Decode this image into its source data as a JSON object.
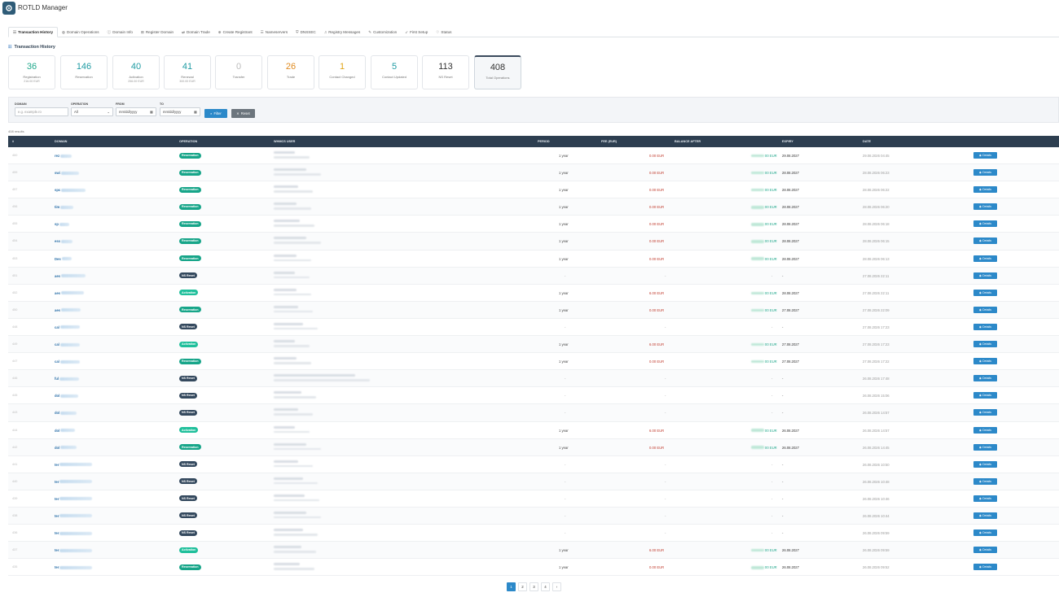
{
  "app": {
    "title": "ROTLD Manager"
  },
  "tabs": [
    {
      "label": "Transaction History",
      "icon": "table-icon",
      "glyph": "☷"
    },
    {
      "label": "Domain Operations",
      "icon": "globe-icon",
      "glyph": "◍"
    },
    {
      "label": "Domain Info",
      "icon": "info-icon",
      "glyph": "ⓘ"
    },
    {
      "label": "Register Domain",
      "icon": "plus-square-icon",
      "glyph": "⊞"
    },
    {
      "label": "Domain Trade",
      "icon": "exchange-icon",
      "glyph": "⇄"
    },
    {
      "label": "Create Registrant",
      "icon": "user-plus-icon",
      "glyph": "⊕"
    },
    {
      "label": "Nameservers",
      "icon": "server-icon",
      "glyph": "☰"
    },
    {
      "label": "DNSSEC",
      "icon": "shield-icon",
      "glyph": "⛨"
    },
    {
      "label": "Registry Messages",
      "icon": "bell-icon",
      "glyph": "♫"
    },
    {
      "label": "Customization",
      "icon": "brush-icon",
      "glyph": "✎"
    },
    {
      "label": "First Setup",
      "icon": "rocket-icon",
      "glyph": "➶"
    },
    {
      "label": "Status",
      "icon": "heartbeat-icon",
      "glyph": "♡"
    }
  ],
  "section_title": "Transaction History",
  "stats": [
    {
      "value": "36",
      "label": "Registration",
      "sub": "216.00 EUR",
      "color": "#1fa88b"
    },
    {
      "value": "146",
      "label": "Reservation",
      "sub": "",
      "color": "#1f9ba3"
    },
    {
      "value": "40",
      "label": "Activation",
      "sub": "256.00 EUR",
      "color": "#1f9ba3"
    },
    {
      "value": "41",
      "label": "Renewal",
      "sub": "300.00 EUR",
      "color": "#1f9ba3"
    },
    {
      "value": "0",
      "label": "Transfer",
      "sub": "",
      "color": "#bbbbbb"
    },
    {
      "value": "26",
      "label": "Trade",
      "sub": "",
      "color": "#e08a1e"
    },
    {
      "value": "1",
      "label": "Contact Changed",
      "sub": "",
      "color": "#e0a416"
    },
    {
      "value": "5",
      "label": "Contact Updated",
      "sub": "",
      "color": "#1f9ba3"
    },
    {
      "value": "113",
      "label": "NS Reset",
      "sub": "",
      "color": "#333333"
    },
    {
      "value": "408",
      "label": "Total Operations",
      "sub": "",
      "color": "#333333"
    }
  ],
  "filters": {
    "domain_label": "DOMAIN",
    "domain_placeholder": "e.g. example.ro",
    "operation_label": "OPERATION",
    "operation_value": "All",
    "from_label": "FROM",
    "from_placeholder": "mm/dd/yyyy",
    "to_label": "TO",
    "to_placeholder": "mm/dd/yyyy",
    "filter_button": "Filter",
    "reset_button": "Reset"
  },
  "results_count": "408 results",
  "table": {
    "headers": [
      "#",
      "DOMAIN",
      "OPERATION",
      "WHMCS USER",
      "PERIOD",
      "FEE (EUR)",
      "BALANCE AFTER",
      "EXPIRY",
      "DATE"
    ],
    "details_label": "Details",
    "rows": [
      {
        "num": "460",
        "domain": "rez",
        "op": "Reservation",
        "period": "1 year",
        "fee": "0.00 EUR",
        "bal": "00 EUR",
        "expiry": "29.08.2027",
        "date": "29.08.2026 04:45"
      },
      {
        "num": "459",
        "domain": "swi",
        "op": "Reservation",
        "period": "1 year",
        "fee": "0.00 EUR",
        "bal": "00 EUR",
        "expiry": "28.08.2027",
        "date": "28.08.2026 06:23"
      },
      {
        "num": "457",
        "domain": "spc",
        "op": "Reservation",
        "period": "1 year",
        "fee": "0.00 EUR",
        "bal": "00 EUR",
        "expiry": "28.08.2027",
        "date": "28.08.2026 06:22"
      },
      {
        "num": "456",
        "domain": "tim",
        "op": "Reservation",
        "period": "1 year",
        "fee": "0.00 EUR",
        "bal": "00 EUR",
        "expiry": "28.08.2027",
        "date": "28.08.2026 06:20"
      },
      {
        "num": "455",
        "domain": "sp",
        "op": "Reservation",
        "period": "1 year",
        "fee": "0.00 EUR",
        "bal": "00 EUR",
        "expiry": "28.08.2027",
        "date": "28.08.2026 06:18"
      },
      {
        "num": "454",
        "domain": "ess",
        "op": "Reservation",
        "period": "1 year",
        "fee": "0.00 EUR",
        "bal": "00 EUR",
        "expiry": "28.08.2027",
        "date": "28.08.2026 06:15"
      },
      {
        "num": "453",
        "domain": "Des",
        "op": "Reservation",
        "period": "1 year",
        "fee": "0.00 EUR",
        "bal": "00 EUR",
        "expiry": "28.08.2027",
        "date": "28.08.2026 06:13"
      },
      {
        "num": "451",
        "domain": "aes",
        "op": "NS Reset",
        "period": "-",
        "fee": "-",
        "bal": "-",
        "expiry": "-",
        "date": "27.08.2026 22:11"
      },
      {
        "num": "452",
        "domain": "aes",
        "op": "Activation",
        "period": "1 year",
        "fee": "6.00 EUR",
        "bal": "00 EUR",
        "expiry": "28.08.2027",
        "date": "27.08.2026 22:11"
      },
      {
        "num": "450",
        "domain": "aes",
        "op": "Reservation",
        "period": "1 year",
        "fee": "0.00 EUR",
        "bal": "00 EUR",
        "expiry": "27.08.2027",
        "date": "27.08.2026 22:09"
      },
      {
        "num": "448",
        "domain": "cal",
        "op": "NS Reset",
        "period": "-",
        "fee": "-",
        "bal": "-",
        "expiry": "-",
        "date": "27.08.2026 17:23"
      },
      {
        "num": "449",
        "domain": "cal",
        "op": "Activation",
        "period": "1 year",
        "fee": "6.00 EUR",
        "bal": "00 EUR",
        "expiry": "27.08.2027",
        "date": "27.08.2026 17:23"
      },
      {
        "num": "447",
        "domain": "cal",
        "op": "Reservation",
        "period": "1 year",
        "fee": "0.00 EUR",
        "bal": "00 EUR",
        "expiry": "27.08.2027",
        "date": "27.08.2026 17:22"
      },
      {
        "num": "446",
        "domain": "ful",
        "op": "NS Reset",
        "period": "-",
        "fee": "-",
        "bal": "-",
        "expiry": "-",
        "date": "26.08.2026 17:48"
      },
      {
        "num": "445",
        "domain": "dol",
        "op": "NS Reset",
        "period": "-",
        "fee": "-",
        "bal": "-",
        "expiry": "-",
        "date": "26.08.2026 15:06"
      },
      {
        "num": "443",
        "domain": "dol",
        "op": "NS Reset",
        "period": "-",
        "fee": "-",
        "bal": "-",
        "expiry": "-",
        "date": "26.08.2026 14:57"
      },
      {
        "num": "444",
        "domain": "dol",
        "op": "Activation",
        "period": "1 year",
        "fee": "6.00 EUR",
        "bal": "00 EUR",
        "expiry": "26.08.2027",
        "date": "26.08.2026 14:57"
      },
      {
        "num": "442",
        "domain": "dol",
        "op": "Reservation",
        "period": "1 year",
        "fee": "0.00 EUR",
        "bal": "00 EUR",
        "expiry": "26.08.2027",
        "date": "26.08.2026 14:45"
      },
      {
        "num": "441",
        "domain": "ter",
        "op": "NS Reset",
        "period": "-",
        "fee": "-",
        "bal": "-",
        "expiry": "-",
        "date": "26.08.2026 10:50"
      },
      {
        "num": "440",
        "domain": "ter",
        "op": "NS Reset",
        "period": "-",
        "fee": "-",
        "bal": "-",
        "expiry": "-",
        "date": "26.08.2026 10:48"
      },
      {
        "num": "439",
        "domain": "ter",
        "op": "NS Reset",
        "period": "-",
        "fee": "-",
        "bal": "-",
        "expiry": "-",
        "date": "26.08.2026 10:46"
      },
      {
        "num": "438",
        "domain": "ter",
        "op": "NS Reset",
        "period": "-",
        "fee": "-",
        "bal": "-",
        "expiry": "-",
        "date": "26.08.2026 10:44"
      },
      {
        "num": "436",
        "domain": "ter",
        "op": "NS Reset",
        "period": "-",
        "fee": "-",
        "bal": "-",
        "expiry": "-",
        "date": "26.08.2026 09:59"
      },
      {
        "num": "437",
        "domain": "ter",
        "op": "Activation",
        "period": "1 year",
        "fee": "6.00 EUR",
        "bal": "00 EUR",
        "expiry": "26.08.2027",
        "date": "26.08.2026 09:59"
      },
      {
        "num": "435",
        "domain": "ter",
        "op": "Reservation",
        "period": "1 year",
        "fee": "0.00 EUR",
        "bal": "00 EUR",
        "expiry": "26.08.2027",
        "date": "26.08.2026 09:52"
      }
    ]
  },
  "pagination": [
    "1",
    "2",
    "3",
    "4",
    "›"
  ]
}
